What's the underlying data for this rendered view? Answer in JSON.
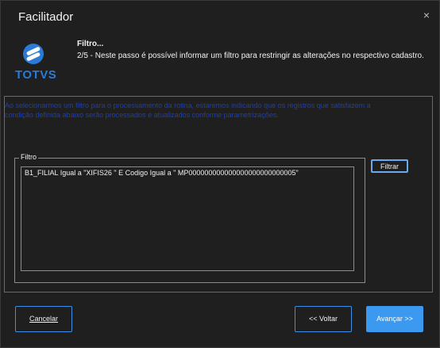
{
  "window": {
    "title": "Facilitador",
    "close_label": "×"
  },
  "logo": {
    "text": "TOTVS",
    "color": "#2b7bd6"
  },
  "step": {
    "title": "Filtro...",
    "description": "2/5 - Neste passo é possível informar um filtro para restringir as alterações no respectivo cadastro."
  },
  "info": {
    "text": "Ao selecionarmos um filtro para o processamento da rotina, estaremos indicando que os registros que satisfazem a condição definida abaixo serão processados e atualizados conforme parametrizações."
  },
  "filter": {
    "legend": "Filtro",
    "value": "B1_FILIAL Igual a   \"XIFIS26 \"   E   Codigo Igual a   \" MP000000000000000000000000005\"",
    "button_label": "Filtrar"
  },
  "footer": {
    "cancel_label": "Cancelar",
    "back_label": "<< Voltar",
    "next_label": "Avançar >>"
  },
  "colors": {
    "accent": "#3b9af0",
    "info_text": "#1f3fb0",
    "background": "#1f1f1f"
  }
}
